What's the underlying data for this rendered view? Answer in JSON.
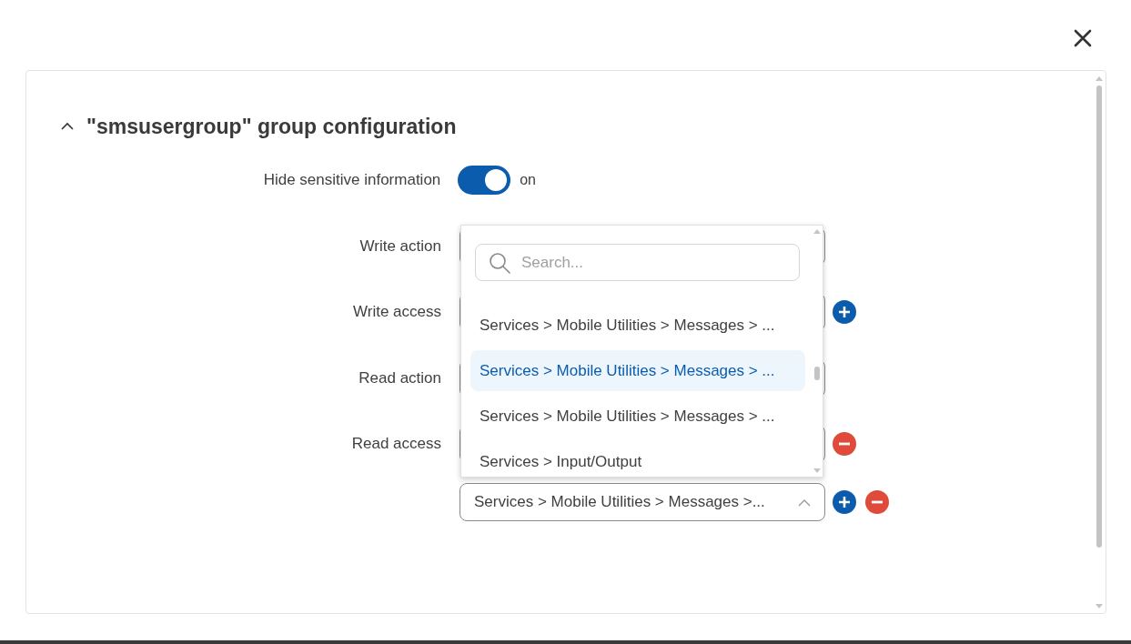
{
  "section": {
    "title": "\"smsusergroup\" group configuration",
    "expanded": true
  },
  "toggle": {
    "label": "Hide sensitive information",
    "on": true,
    "state_text": "on"
  },
  "rows": [
    {
      "label": "Write action",
      "can_add": false,
      "can_remove": false
    },
    {
      "label": "Write access",
      "can_add": true,
      "can_remove": false
    },
    {
      "label": "Read action",
      "can_add": false,
      "can_remove": false
    },
    {
      "label": "Read access",
      "can_add": false,
      "can_remove": true
    },
    {
      "value": "Services > Mobile Utilities > Messages >...",
      "open": true,
      "can_add": true,
      "can_remove": true
    }
  ],
  "dropdown": {
    "search": {
      "placeholder": "Search..."
    },
    "items": [
      {
        "label": "Services > Mobile Utilities > Messages > ...",
        "selected": false
      },
      {
        "label": "Services > Mobile Utilities > Messages > ...",
        "selected": true
      },
      {
        "label": "Services > Mobile Utilities > Messages > ...",
        "selected": false
      },
      {
        "label": "Services > Input/Output",
        "selected": false
      }
    ]
  }
}
